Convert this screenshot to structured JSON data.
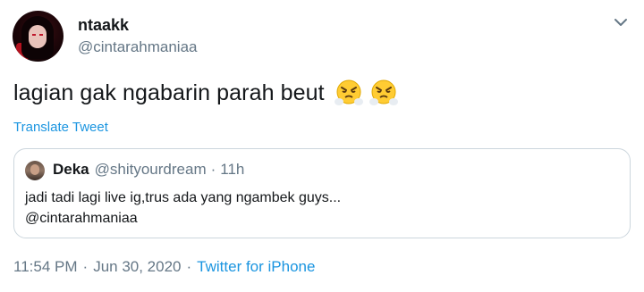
{
  "author": {
    "name": "ntaakk",
    "handle": "@cintarahmaniaa"
  },
  "tweet": {
    "text": "lagian gak ngabarin parah beut",
    "emojis": [
      "face-with-steam-from-nose",
      "face-with-steam-from-nose"
    ],
    "translate_label": "Translate Tweet"
  },
  "quoted_tweet": {
    "name": "Deka",
    "handle": "@shityourdream",
    "separator": "·",
    "time": "11h",
    "line1": "jadi tadi lagi live ig,trus ada yang ngambek guys...",
    "line2": "@cintarahmaniaa"
  },
  "footer": {
    "time": "11:54 PM",
    "separator": "·",
    "date": "Jun 30, 2020",
    "source": "Twitter for iPhone"
  },
  "colors": {
    "link": "#1b95e0",
    "muted": "#657786",
    "text": "#14171a",
    "border": "#ccd6dd"
  }
}
